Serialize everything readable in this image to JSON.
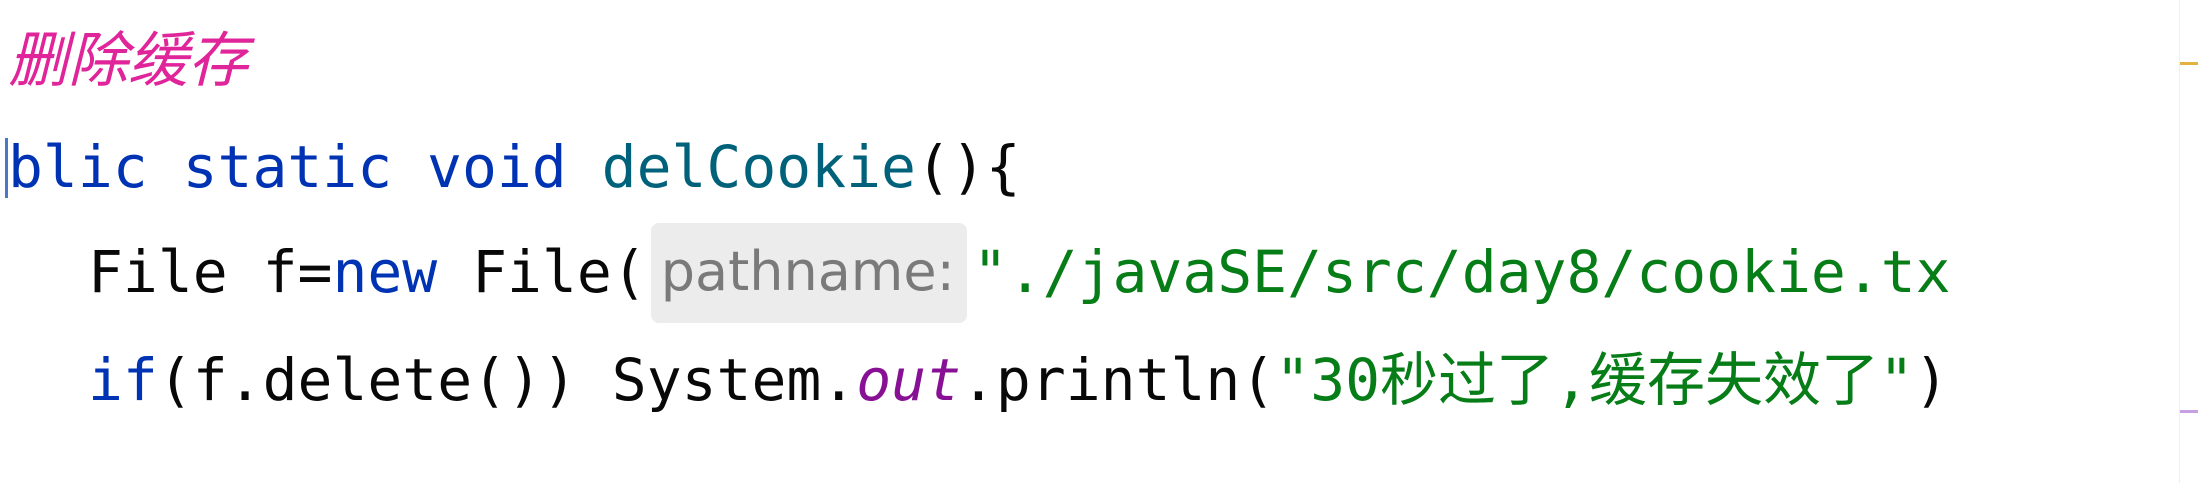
{
  "comment": "删除缓存",
  "line1": {
    "kw1": "blic",
    "kw2": "static",
    "kw3": "void",
    "method_name": "delCookie",
    "rest": "(){"
  },
  "line2": {
    "type": "File f=",
    "kw_new": "new",
    "ctor": " File(",
    "param_hint": "pathname:",
    "string": "\"./javaSE/src/day8/cookie.tx"
  },
  "line3": {
    "kw_if": "if",
    "cond": "(f.delete()) System.",
    "field": "out",
    "call": ".println(",
    "string": "\"30秒过了,缓存失效了\"",
    "close": ")"
  },
  "colors": {
    "keyword": "#0033b3",
    "method": "#00627a",
    "string": "#067d17",
    "static_field": "#871094",
    "comment": "#e0249a",
    "param_hint_bg": "#ececec"
  }
}
